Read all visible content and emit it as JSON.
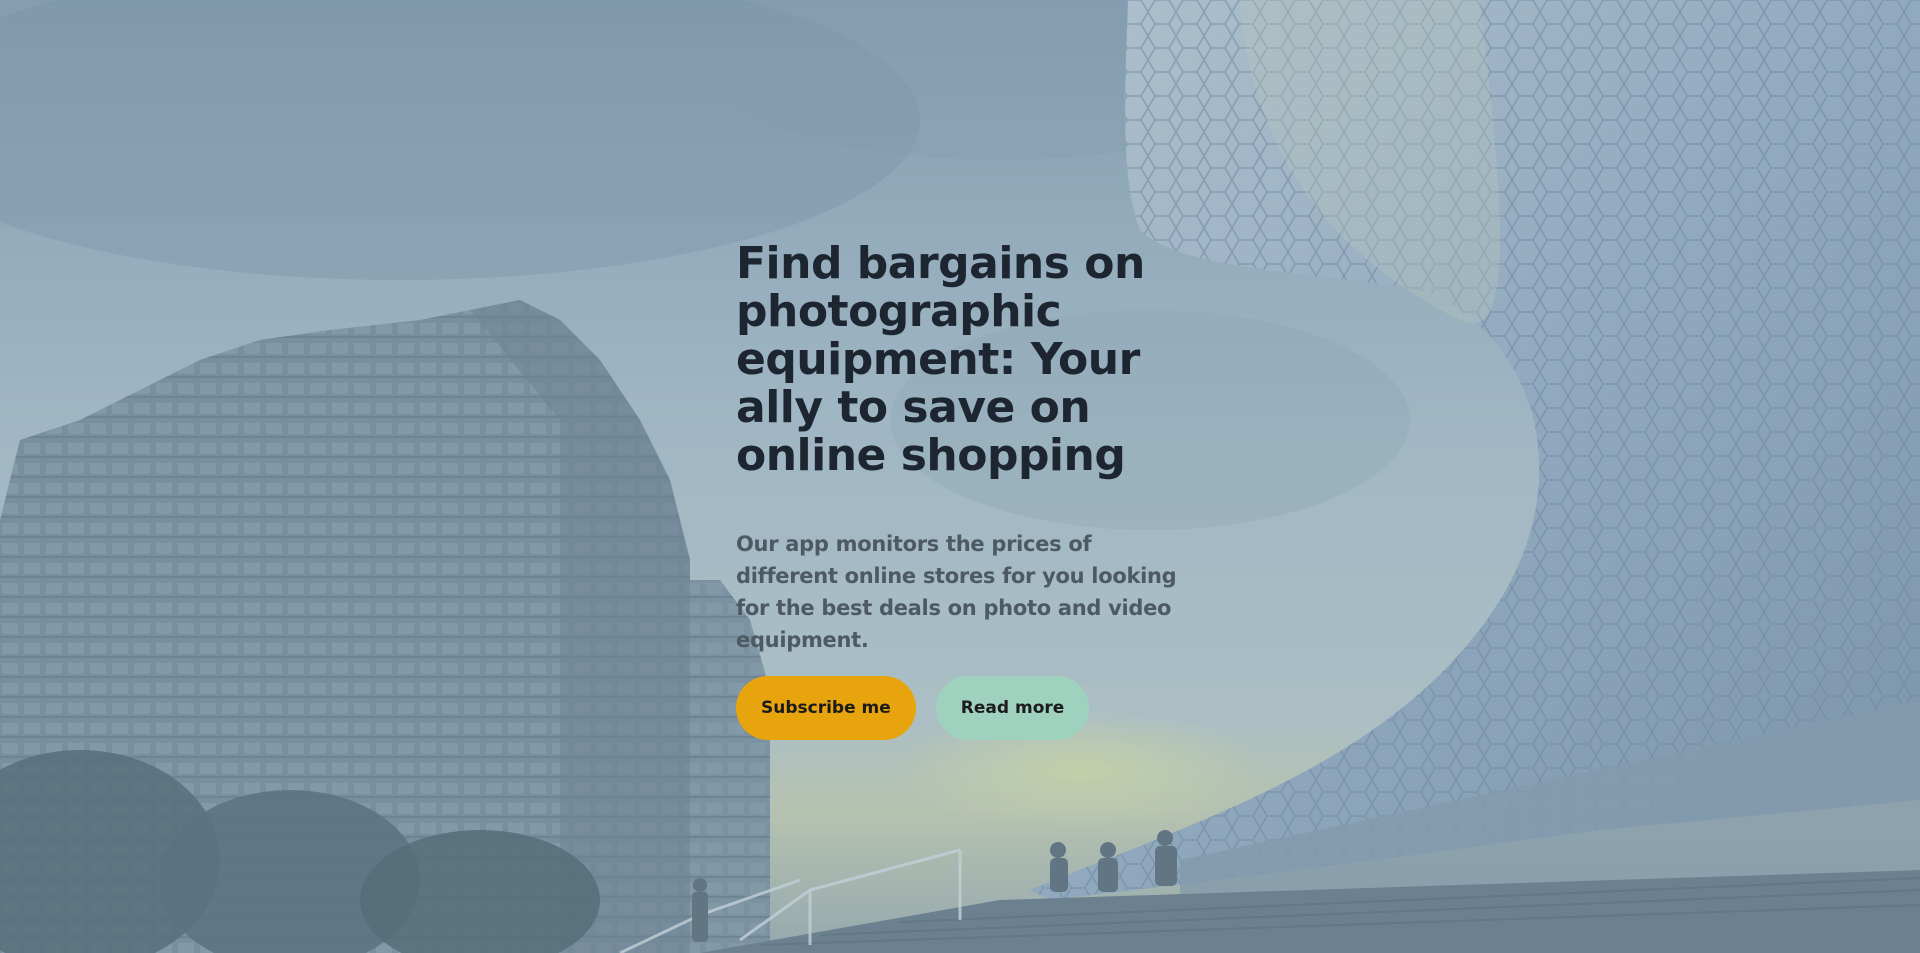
{
  "hero": {
    "title": "Find bargains on photographic equipment: Your ally to save on online shopping",
    "description": "Our app monitors the prices of different online stores for you looking for the best deals on photo and video equipment.",
    "subscribe_label": "Subscribe me",
    "read_more_label": "Read more"
  },
  "colors": {
    "primary_button": "#e8a40c",
    "secondary_button": "#9fd1bf",
    "title_text": "#1c2530",
    "body_text": "#4d5a64"
  }
}
